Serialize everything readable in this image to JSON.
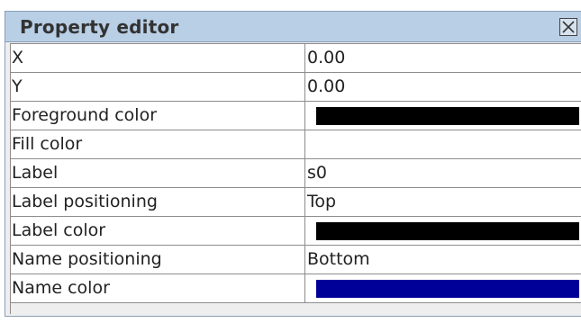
{
  "panel": {
    "title": "Property editor",
    "close_icon": "close-box-icon"
  },
  "properties": [
    {
      "name": "X",
      "value": "0.00",
      "kind": "text"
    },
    {
      "name": "Y",
      "value": "0.00",
      "kind": "text"
    },
    {
      "name": "Foreground color",
      "kind": "color",
      "color": "#000000"
    },
    {
      "name": "Fill color",
      "value": "",
      "kind": "text"
    },
    {
      "name": "Label",
      "value": "s0",
      "kind": "text"
    },
    {
      "name": "Label positioning",
      "value": "Top",
      "kind": "text"
    },
    {
      "name": "Label color",
      "kind": "color",
      "color": "#000000"
    },
    {
      "name": "Name positioning",
      "value": "Bottom",
      "kind": "text"
    },
    {
      "name": "Name color",
      "kind": "color",
      "color": "#000099"
    }
  ]
}
